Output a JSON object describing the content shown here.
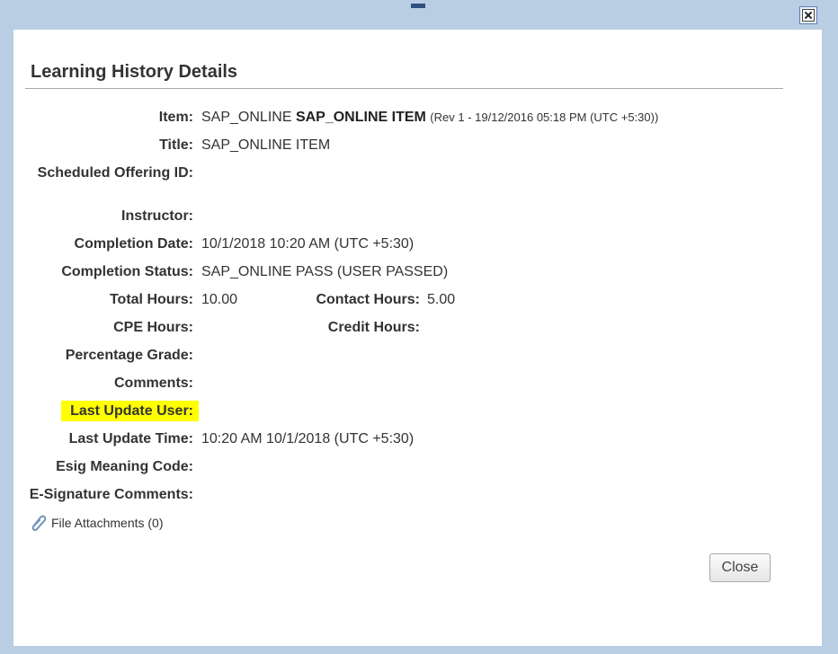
{
  "dialog": {
    "title": "Learning History Details",
    "close_button_label": "Close"
  },
  "fields": {
    "item": {
      "label": "Item:",
      "value_prefix": "SAP_ONLINE",
      "value_bold": "SAP_ONLINE ITEM",
      "value_rev": "(Rev 1 - 19/12/2016 05:18 PM (UTC +5:30))"
    },
    "title": {
      "label": "Title:",
      "value": "SAP_ONLINE ITEM"
    },
    "scheduled_offering_id": {
      "label": "Scheduled Offering ID:",
      "value": ""
    },
    "instructor": {
      "label": "Instructor:",
      "value": ""
    },
    "completion_date": {
      "label": "Completion Date:",
      "value": "10/1/2018 10:20 AM (UTC +5:30)"
    },
    "completion_status": {
      "label": "Completion Status:",
      "value": "SAP_ONLINE PASS (USER PASSED)"
    },
    "total_hours": {
      "label": "Total Hours:",
      "value": "10.00"
    },
    "contact_hours": {
      "label": "Contact Hours:",
      "value": "5.00"
    },
    "cpe_hours": {
      "label": "CPE Hours:",
      "value": ""
    },
    "credit_hours": {
      "label": "Credit Hours:",
      "value": ""
    },
    "percentage_grade": {
      "label": "Percentage Grade:",
      "value": ""
    },
    "comments": {
      "label": "Comments:",
      "value": ""
    },
    "last_update_user": {
      "label": "Last Update User:",
      "value": "",
      "highlight_color": "#ffff00"
    },
    "last_update_time": {
      "label": "Last Update Time:",
      "value": "10:20 AM 10/1/2018 (UTC +5:30)"
    },
    "esig_meaning_code": {
      "label": "Esig Meaning Code:",
      "value": ""
    },
    "esignature_comments": {
      "label": "E-Signature Comments:",
      "value": ""
    }
  },
  "attachments": {
    "label": "File Attachments (0)",
    "icon": "paperclip-icon"
  },
  "colors": {
    "backdrop": "#b9cde3",
    "highlight": "#ffff00"
  }
}
